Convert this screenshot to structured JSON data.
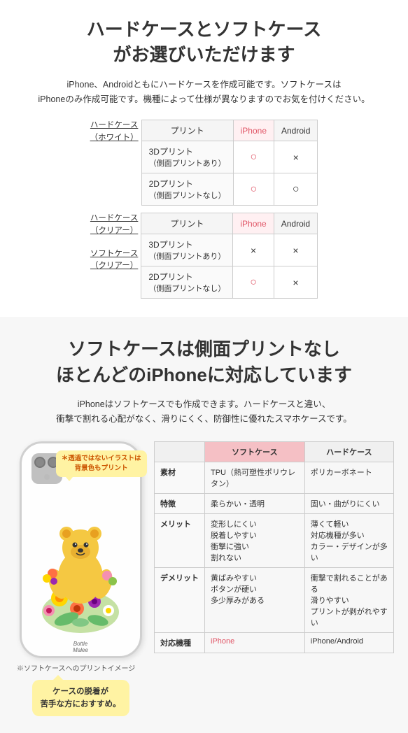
{
  "section1": {
    "title": "ハードケースとソフトケース\nがお選びいただけます",
    "desc": "iPhone、Androidともにハードケースを作成可能です。ソフトケースは\niPhoneのみ作成可能です。機種によって仕様が異なりますのでお気を付けください。",
    "table1": {
      "row_label": "ハードケース（ホワイト）",
      "col_print": "プリント",
      "col_iphone": "iPhone",
      "col_android": "Android",
      "rows": [
        {
          "label": "3Dプリント\n（側面プリントあり）",
          "iphone": "○",
          "android": "×"
        },
        {
          "label": "2Dプリント\n（側面プリントなし）",
          "iphone": "○",
          "android": "○"
        }
      ]
    },
    "table2": {
      "labels": [
        "ハードケース（クリアー）",
        "ソフトケース（クリアー）"
      ],
      "col_print": "プリント",
      "col_iphone": "iPhone",
      "col_android": "Android",
      "rows": [
        {
          "label": "3Dプリント\n（側面プリントあり）",
          "iphone": "×",
          "android": "×"
        },
        {
          "label": "2Dプリント\n（側面プリントなし）",
          "iphone": "○",
          "android": "×"
        }
      ]
    }
  },
  "section2": {
    "title": "ソフトケースは側面プリントなし\nほとんどのiPhoneに対応しています",
    "desc": "iPhoneはソフトケースでも作成できます。ハードケースと違い、\n衝撃で割れる心配がなく、滑りにくく、防御性に優れたスマホケースです。",
    "note_bubble": "＊透過ではないイラストは\n背景色もプリント",
    "callout": "ケースの脱着が\n苦手な方におすすめ。",
    "footer_note": "※ソフトケースへのプリントイメージ",
    "table": {
      "col_soft": "ソフトケース",
      "col_hard": "ハードケース",
      "rows": [
        {
          "label": "素材",
          "soft": "TPU（熱可塑性ポリウレタン）",
          "hard": "ポリカーボネート"
        },
        {
          "label": "特徴",
          "soft": "柔らかい・透明",
          "hard": "固い・曲がりにくい"
        },
        {
          "label": "メリット",
          "soft": "変形しにくい\n脱着しやすい\n衝撃に強い\n割れない",
          "hard": "薄くて軽い\n対応機種が多い\nカラー・デザインが多い"
        },
        {
          "label": "デメリット",
          "soft": "黄ばみやすい\nボタンが硬い\n多少厚みがある",
          "hard": "衝撃で割れることがある\n滑りやすい\nプリントが剥がれやすい"
        },
        {
          "label": "対応機種",
          "soft": "iPhone",
          "hard": "iPhone/Android"
        }
      ]
    }
  }
}
